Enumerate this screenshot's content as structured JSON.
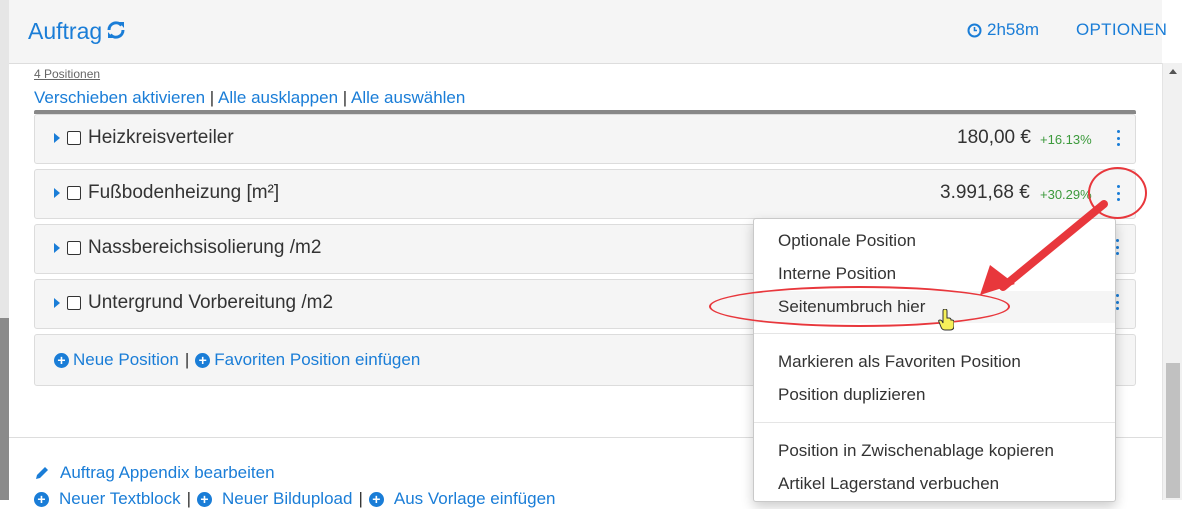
{
  "header": {
    "title": "Auftrag",
    "timer": "2h58m",
    "options_label": "OPTIONEN"
  },
  "list": {
    "count_label": "4 Positionen",
    "actions": [
      "Verschieben aktivieren",
      "Alle ausklappen",
      "Alle auswählen"
    ],
    "rows": [
      {
        "name": "Heizkreisverteiler",
        "price": "180,00 €",
        "percent": "+16.13%"
      },
      {
        "name": "Fußbodenheizung [m²]",
        "price": "3.991,68 €",
        "percent": "+30.29%"
      },
      {
        "name": "Nassbereichsisolierung /m2"
      },
      {
        "name": "Untergrund Vorbereitung /m2"
      }
    ],
    "add_position": "Neue Position",
    "add_favorite": "Favoriten Position einfügen"
  },
  "footer": {
    "appendix": "Auftrag Appendix bearbeiten",
    "new_textblock": "Neuer Textblock",
    "new_image": "Neuer Bildupload",
    "from_template": "Aus Vorlage einfügen"
  },
  "context_menu": {
    "items": [
      "Optionale Position",
      "Interne Position",
      "Seitenumbruch hier",
      "Markieren als Favoriten Position",
      "Position duplizieren",
      "Position in Zwischenablage kopieren",
      "Artikel Lagerstand verbuchen"
    ],
    "highlighted_index": 2
  },
  "colors": {
    "accent": "#1a7dd7",
    "positive": "#3c9a3c",
    "annotation": "#e8373c"
  },
  "icons": [
    "refresh-icon",
    "clock-icon",
    "caret-right-icon",
    "checkbox-icon",
    "kebab-icon",
    "plus-circle-icon",
    "pencil-icon",
    "hand-cursor-icon"
  ]
}
